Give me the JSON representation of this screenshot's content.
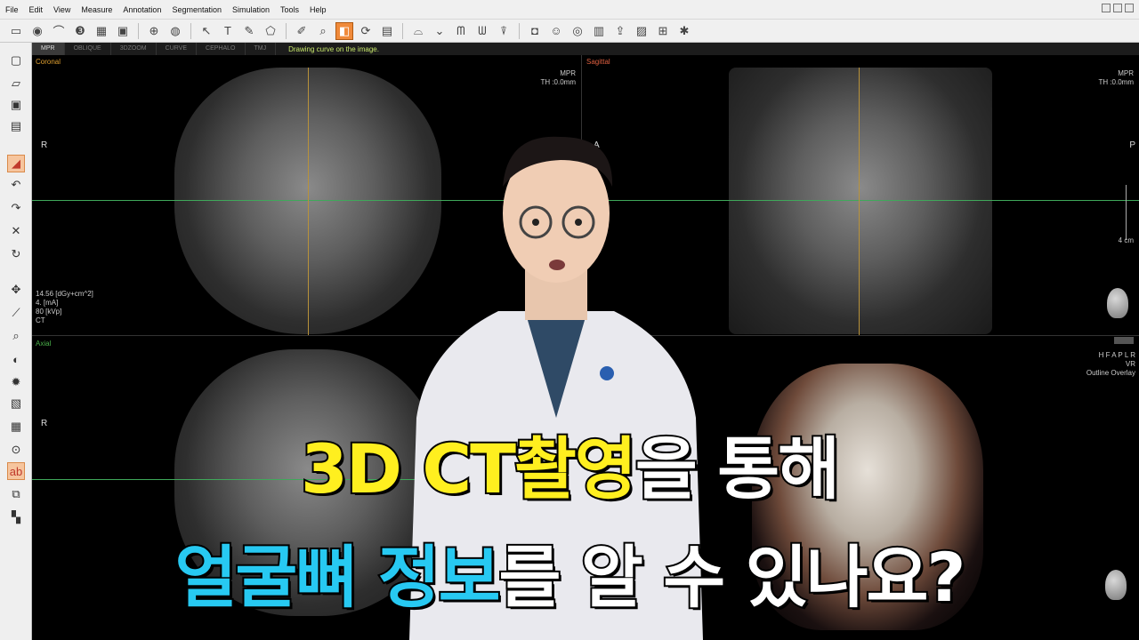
{
  "menu": [
    "File",
    "Edit",
    "View",
    "Measure",
    "Annotation",
    "Segmentation",
    "Simulation",
    "Tools",
    "Help"
  ],
  "tabs": [
    "MPR",
    "OBLIQUE",
    "3DZOOM",
    "CURVE",
    "CEPHALO",
    "TMJ"
  ],
  "status_message": "Drawing curve on the image.",
  "toolbar_icons": [
    "ruler-icon",
    "eye-icon",
    "arch-icon",
    "3d-icon",
    "panorama-icon",
    "layout-icon",
    "globe-icon",
    "tooth-icon",
    "cursor-icon",
    "text-icon",
    "pen-icon",
    "shape-icon",
    "edit-icon",
    "zoom-icon",
    "layers-icon",
    "rotate-icon",
    "clipboard-icon",
    "curve-icon",
    "manual-curve-icon",
    "teeth-icon",
    "manual-teeth-icon",
    "implant-icon",
    "camera-icon",
    "user-icon",
    "disc-icon",
    "save-icon",
    "export-icon",
    "print-icon",
    "grid-icon",
    "settings-icon"
  ],
  "left_icons": [
    "new-icon",
    "open-icon",
    "save-icon",
    "print-icon",
    "draw-icon",
    "undo-icon",
    "redo-icon",
    "delete-icon",
    "rotate-icon",
    "move-icon",
    "measure-icon",
    "zoom-icon",
    "contrast-icon",
    "brightness-icon",
    "gradient-icon",
    "sharpen-icon",
    "magnify-icon",
    "text-annotate-icon",
    "copy-icon",
    "checker-icon"
  ],
  "viewports": {
    "coronal": {
      "label": "Coronal",
      "label_color": "#e0a030",
      "mode": "MPR",
      "thickness": "TH :0.0mm",
      "orient_left": "R",
      "dose": "14.56  [dGy+cm^2]",
      "ma": "4.  [mA]",
      "kvp": "80  [kVp]",
      "modality": "CT"
    },
    "sagittal": {
      "label": "Sagittal",
      "label_color": "#e06040",
      "mode": "MPR",
      "thickness": "TH :0.0mm",
      "orient_left": "A",
      "orient_right": "P",
      "scale": "4 cm"
    },
    "axial": {
      "label": "Axial",
      "label_color": "#4ab04a",
      "orient_left": "R"
    },
    "volume": {
      "orient": "H F A P L R",
      "mode": "VR",
      "overlay": "Outline Overlay"
    }
  },
  "caption": {
    "line1_highlight": "3D CT촬영",
    "line1_rest": "을 통해",
    "line2_highlight": "얼굴뼈 정보",
    "line2_rest": "를 알 수 있나요?"
  }
}
